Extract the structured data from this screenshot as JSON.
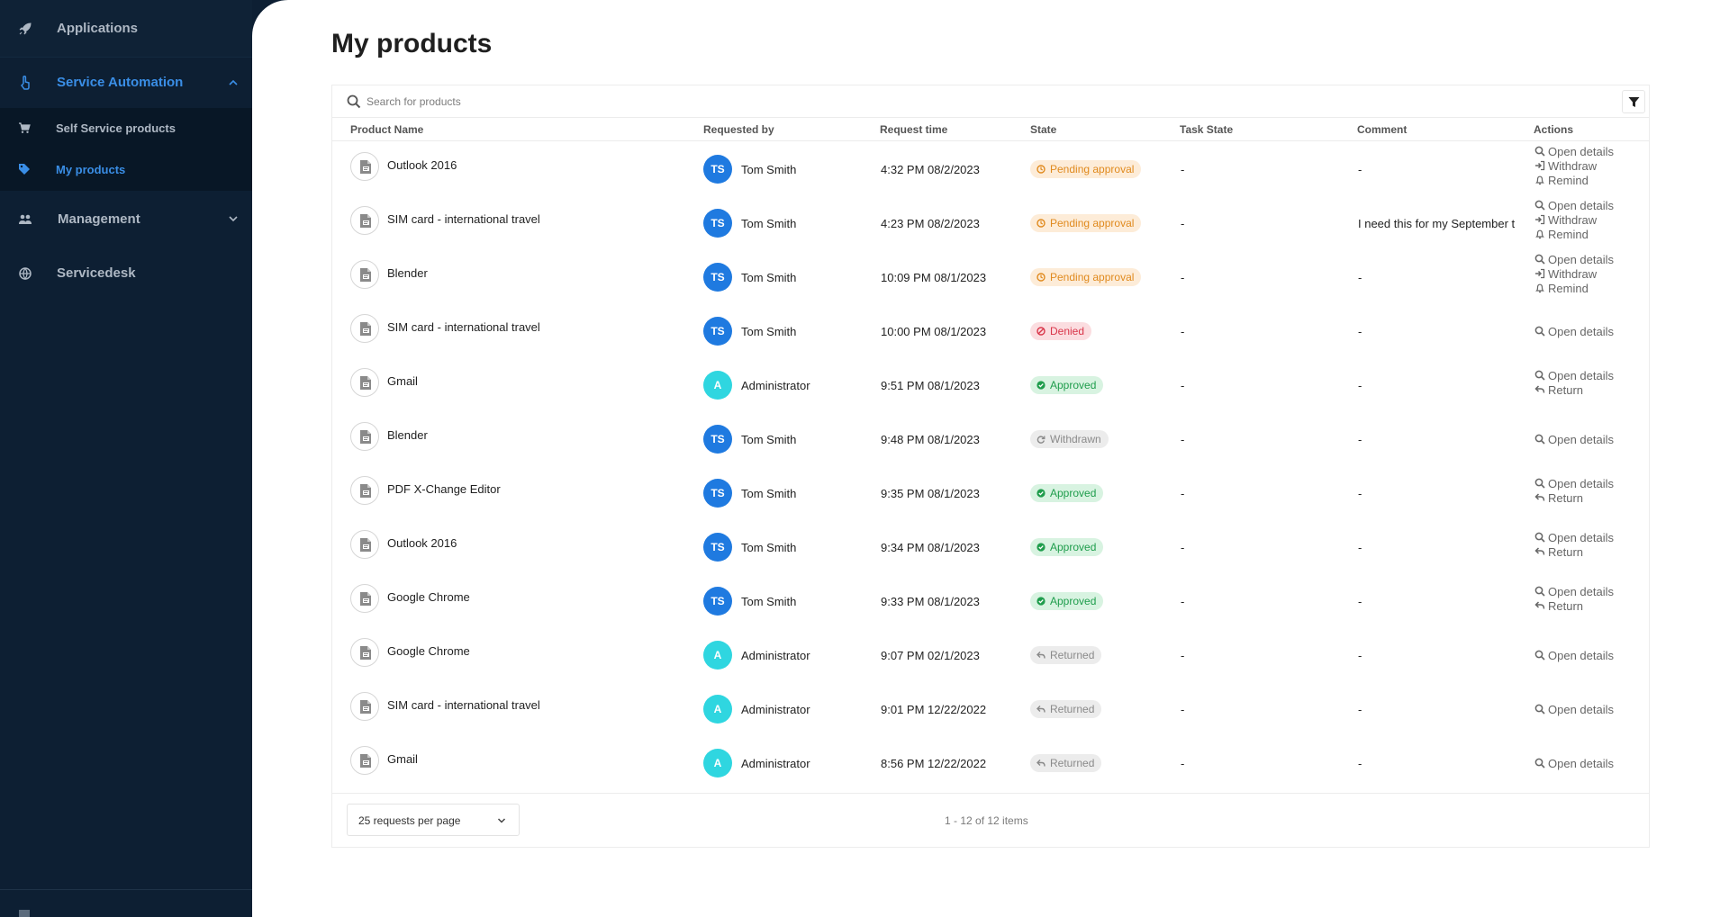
{
  "sidebar": {
    "items": [
      {
        "label": "Applications",
        "icon": "rocket-icon"
      },
      {
        "label": "Service Automation",
        "icon": "hand-pointer-icon"
      },
      {
        "label": "Management",
        "icon": "users-icon"
      },
      {
        "label": "Servicedesk",
        "icon": "globe-icon"
      }
    ],
    "sub_items": [
      {
        "label": "Self Service products",
        "icon": "cart-icon"
      },
      {
        "label": "My products",
        "icon": "tag-icon"
      }
    ],
    "accent_color": "#3a8ee6"
  },
  "page": {
    "title": "My products",
    "search_placeholder": "Search for products"
  },
  "table": {
    "headers": [
      "Product Name",
      "Requested by",
      "Request time",
      "State",
      "Task State",
      "Comment",
      "Actions"
    ],
    "rows": [
      {
        "product": "Outlook 2016",
        "initials": "TS",
        "user": "Tom Smith",
        "time": "4:32 PM 08/2/2023",
        "state": "Pending approval",
        "task": "-",
        "comment": "-",
        "actions": [
          "Open details",
          "Withdraw",
          "Remind"
        ]
      },
      {
        "product": "SIM card - international travel",
        "initials": "TS",
        "user": "Tom Smith",
        "time": "4:23 PM 08/2/2023",
        "state": "Pending approval",
        "task": "-",
        "comment": "I need this for my September t",
        "actions": [
          "Open details",
          "Withdraw",
          "Remind"
        ]
      },
      {
        "product": "Blender",
        "initials": "TS",
        "user": "Tom Smith",
        "time": "10:09 PM 08/1/2023",
        "state": "Pending approval",
        "task": "-",
        "comment": "-",
        "actions": [
          "Open details",
          "Withdraw",
          "Remind"
        ]
      },
      {
        "product": "SIM card - international travel",
        "initials": "TS",
        "user": "Tom Smith",
        "time": "10:00 PM 08/1/2023",
        "state": "Denied",
        "task": "-",
        "comment": "-",
        "actions": [
          "Open details"
        ]
      },
      {
        "product": "Gmail",
        "initials": "A",
        "user": "Administrator",
        "time": "9:51 PM 08/1/2023",
        "state": "Approved",
        "task": "-",
        "comment": "-",
        "actions": [
          "Open details",
          "Return"
        ]
      },
      {
        "product": "Blender",
        "initials": "TS",
        "user": "Tom Smith",
        "time": "9:48 PM 08/1/2023",
        "state": "Withdrawn",
        "task": "-",
        "comment": "-",
        "actions": [
          "Open details"
        ]
      },
      {
        "product": "PDF X-Change Editor",
        "initials": "TS",
        "user": "Tom Smith",
        "time": "9:35 PM 08/1/2023",
        "state": "Approved",
        "task": "-",
        "comment": "-",
        "actions": [
          "Open details",
          "Return"
        ]
      },
      {
        "product": "Outlook 2016",
        "initials": "TS",
        "user": "Tom Smith",
        "time": "9:34 PM 08/1/2023",
        "state": "Approved",
        "task": "-",
        "comment": "-",
        "actions": [
          "Open details",
          "Return"
        ]
      },
      {
        "product": "Google Chrome",
        "initials": "TS",
        "user": "Tom Smith",
        "time": "9:33 PM 08/1/2023",
        "state": "Approved",
        "task": "-",
        "comment": "-",
        "actions": [
          "Open details",
          "Return"
        ]
      },
      {
        "product": "Google Chrome",
        "initials": "A",
        "user": "Administrator",
        "time": "9:07 PM 02/1/2023",
        "state": "Returned",
        "task": "-",
        "comment": "-",
        "actions": [
          "Open details"
        ]
      },
      {
        "product": "SIM card - international travel",
        "initials": "A",
        "user": "Administrator",
        "time": "9:01 PM 12/22/2022",
        "state": "Returned",
        "task": "-",
        "comment": "-",
        "actions": [
          "Open details"
        ]
      },
      {
        "product": "Gmail",
        "initials": "A",
        "user": "Administrator",
        "time": "8:56 PM 12/22/2022",
        "state": "Returned",
        "task": "-",
        "comment": "-",
        "actions": [
          "Open details"
        ]
      }
    ]
  },
  "state_styles": {
    "Pending approval": {
      "bg": "#fdecd8",
      "fg": "#e08a1e",
      "icon": "clock-icon"
    },
    "Denied": {
      "bg": "#fbdde0",
      "fg": "#d9364a",
      "icon": "ban-icon"
    },
    "Approved": {
      "bg": "#d8f3e1",
      "fg": "#1f9d4c",
      "icon": "check-circle-icon"
    },
    "Withdrawn": {
      "bg": "#ececec",
      "fg": "#8a8a8a",
      "icon": "redo-icon"
    },
    "Returned": {
      "bg": "#ececec",
      "fg": "#8a8a8a",
      "icon": "reply-icon"
    }
  },
  "avatar_colors": {
    "TS": "#1f7ae0",
    "A": "#2fd6e0"
  },
  "pagination": {
    "per_page_label": "25 requests per page",
    "info": "1 - 12 of 12 items"
  }
}
